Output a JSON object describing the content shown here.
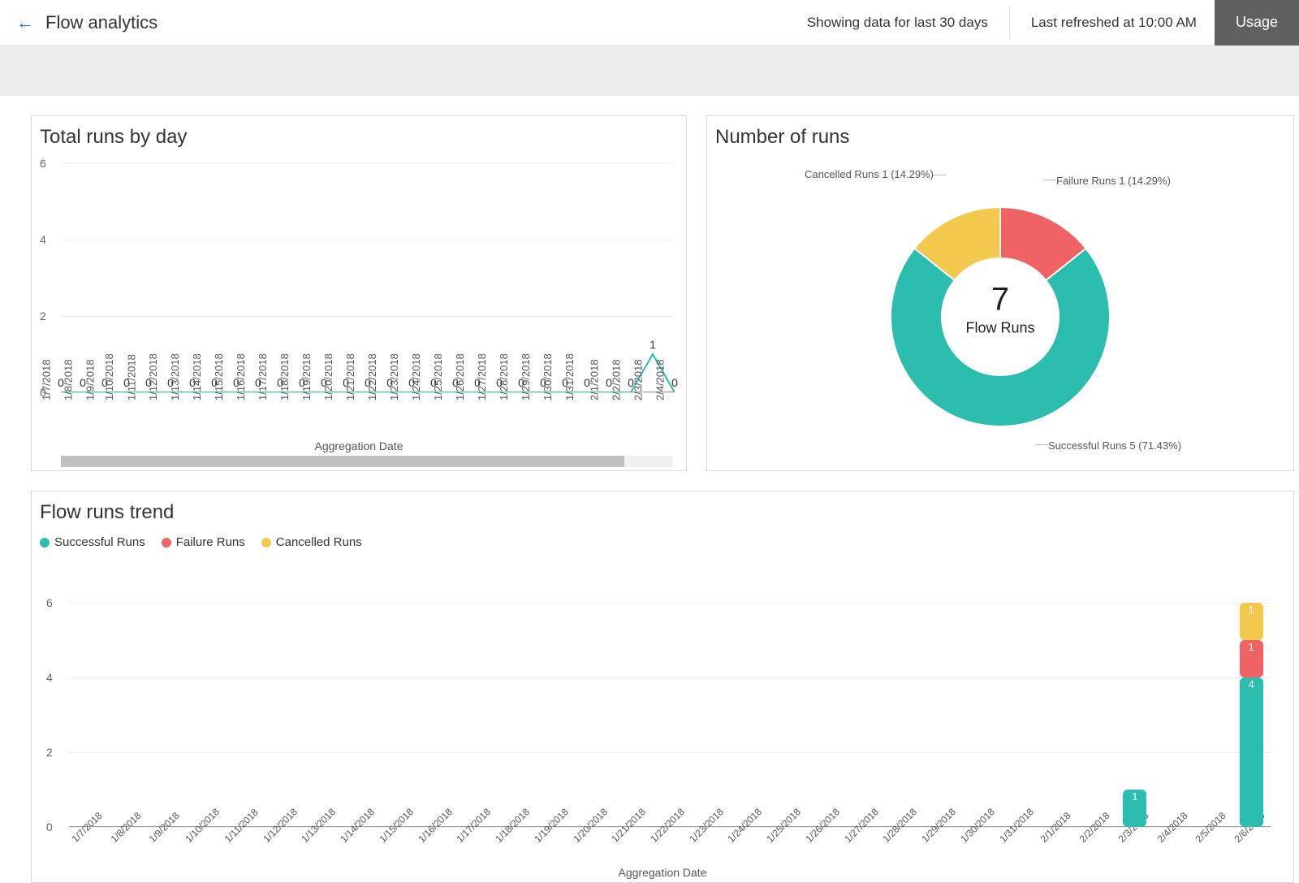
{
  "header": {
    "title": "Flow analytics",
    "data_window": "Showing data for last 30 days",
    "refreshed": "Last refreshed at 10:00 AM",
    "usage_button": "Usage"
  },
  "colors": {
    "success": "#2bbdad",
    "failure": "#ef6364",
    "cancelled": "#f2c94c",
    "axis": "#999999"
  },
  "chart_data": [
    {
      "id": "total_runs_by_day",
      "title": "Total runs by day",
      "type": "line",
      "xlabel": "Aggregation Date",
      "ylabel": "",
      "ylim": [
        0,
        6
      ],
      "yticks": [
        0,
        2,
        4,
        6
      ],
      "categories": [
        "1/7/2018",
        "1/8/2018",
        "1/9/2018",
        "1/10/2018",
        "1/11/2018",
        "1/12/2018",
        "1/13/2018",
        "1/14/2018",
        "1/15/2018",
        "1/16/2018",
        "1/17/2018",
        "1/18/2018",
        "1/19/2018",
        "1/20/2018",
        "1/21/2018",
        "1/22/2018",
        "1/23/2018",
        "1/24/2018",
        "1/25/2018",
        "1/26/2018",
        "1/27/2018",
        "1/28/2018",
        "1/29/2018",
        "1/30/2018",
        "1/31/2018",
        "2/1/2018",
        "2/2/2018",
        "2/3/2018",
        "2/4/2018"
      ],
      "values": [
        0,
        0,
        0,
        0,
        0,
        0,
        0,
        0,
        0,
        0,
        0,
        0,
        0,
        0,
        0,
        0,
        0,
        0,
        0,
        0,
        0,
        0,
        0,
        0,
        0,
        0,
        0,
        1,
        0
      ]
    },
    {
      "id": "number_of_runs",
      "title": "Number of runs",
      "type": "pie",
      "center_value": "7",
      "center_label": "Flow Runs",
      "series": [
        {
          "name": "Successful Runs",
          "value": 5,
          "percent": 71.43,
          "label": "Successful Runs 5 (71.43%)",
          "color": "#2bbdad"
        },
        {
          "name": "Cancelled Runs",
          "value": 1,
          "percent": 14.29,
          "label": "Cancelled Runs 1 (14.29%)",
          "color": "#f2c94c"
        },
        {
          "name": "Failure Runs",
          "value": 1,
          "percent": 14.29,
          "label": "Failure Runs 1 (14.29%)",
          "color": "#ef6364"
        }
      ]
    },
    {
      "id": "flow_runs_trend",
      "title": "Flow runs trend",
      "type": "bar",
      "stacked": true,
      "xlabel": "Aggregation Date",
      "ylabel": "",
      "ylim": [
        0,
        6
      ],
      "yticks": [
        0,
        2,
        4,
        6
      ],
      "legend": [
        "Successful Runs",
        "Failure Runs",
        "Cancelled Runs"
      ],
      "categories": [
        "1/7/2018",
        "1/8/2018",
        "1/9/2018",
        "1/10/2018",
        "1/11/2018",
        "1/12/2018",
        "1/13/2018",
        "1/14/2018",
        "1/15/2018",
        "1/16/2018",
        "1/17/2018",
        "1/18/2018",
        "1/19/2018",
        "1/20/2018",
        "1/21/2018",
        "1/22/2018",
        "1/23/2018",
        "1/24/2018",
        "1/25/2018",
        "1/26/2018",
        "1/27/2018",
        "1/28/2018",
        "1/29/2018",
        "1/30/2018",
        "1/31/2018",
        "2/1/2018",
        "2/2/2018",
        "2/3/2018",
        "2/4/2018",
        "2/5/2018",
        "2/6/2018"
      ],
      "series": [
        {
          "name": "Successful Runs",
          "color": "#2bbdad",
          "values": [
            0,
            0,
            0,
            0,
            0,
            0,
            0,
            0,
            0,
            0,
            0,
            0,
            0,
            0,
            0,
            0,
            0,
            0,
            0,
            0,
            0,
            0,
            0,
            0,
            0,
            0,
            0,
            1,
            0,
            0,
            4
          ]
        },
        {
          "name": "Failure Runs",
          "color": "#ef6364",
          "values": [
            0,
            0,
            0,
            0,
            0,
            0,
            0,
            0,
            0,
            0,
            0,
            0,
            0,
            0,
            0,
            0,
            0,
            0,
            0,
            0,
            0,
            0,
            0,
            0,
            0,
            0,
            0,
            0,
            0,
            0,
            1
          ]
        },
        {
          "name": "Cancelled Runs",
          "color": "#f2c94c",
          "values": [
            0,
            0,
            0,
            0,
            0,
            0,
            0,
            0,
            0,
            0,
            0,
            0,
            0,
            0,
            0,
            0,
            0,
            0,
            0,
            0,
            0,
            0,
            0,
            0,
            0,
            0,
            0,
            0,
            0,
            0,
            1
          ]
        }
      ]
    }
  ]
}
